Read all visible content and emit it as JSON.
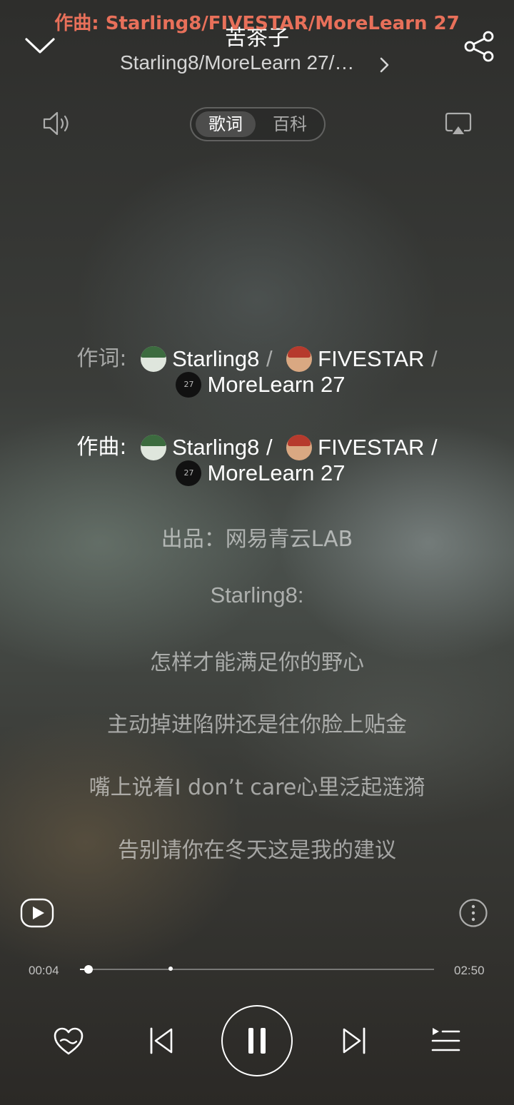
{
  "notification": {
    "text": "作曲: Starling8/FIVESTAR/MoreLearn 27"
  },
  "header": {
    "title": "苦茶子",
    "artists": "Starling8/MoreLearn 27/…"
  },
  "tabs": [
    {
      "label": "歌词",
      "active": true
    },
    {
      "label": "百科",
      "active": false
    }
  ],
  "credits": {
    "lyricist": {
      "label": "作词:",
      "names": [
        "Starling8",
        "FIVESTAR",
        "MoreLearn 27"
      ],
      "separator": "/"
    },
    "composer": {
      "label": "作曲:",
      "names": [
        "Starling8",
        "FIVESTAR",
        "MoreLearn 27"
      ],
      "separator": "/"
    }
  },
  "avatar_badge": "27",
  "lyrics": [
    "出品：网易青云LAB",
    "Starling8:",
    "怎样才能满足你的野心",
    "主动掉进陷阱还是往你脸上贴金",
    "嘴上说着I don’t care心里泛起涟漪",
    "告别请你在冬天这是我的建议"
  ],
  "progress": {
    "current": "00:04",
    "total": "02:50",
    "fraction": 0.024,
    "buffered_fraction": 0.25
  },
  "icons": {
    "collapse": "chevron-down-icon",
    "share": "share-icon",
    "volume": "volume-icon",
    "cast": "cast-icon",
    "video": "video-play-icon",
    "more": "more-icon",
    "like": "heart-icon",
    "prev": "previous-icon",
    "pause": "pause-icon",
    "next": "next-icon",
    "playlist": "playlist-icon"
  },
  "colors": {
    "notification": "#e8705a",
    "highlight_line": "#ffffff",
    "dim_line": "rgba(255,255,255,0.55)"
  }
}
